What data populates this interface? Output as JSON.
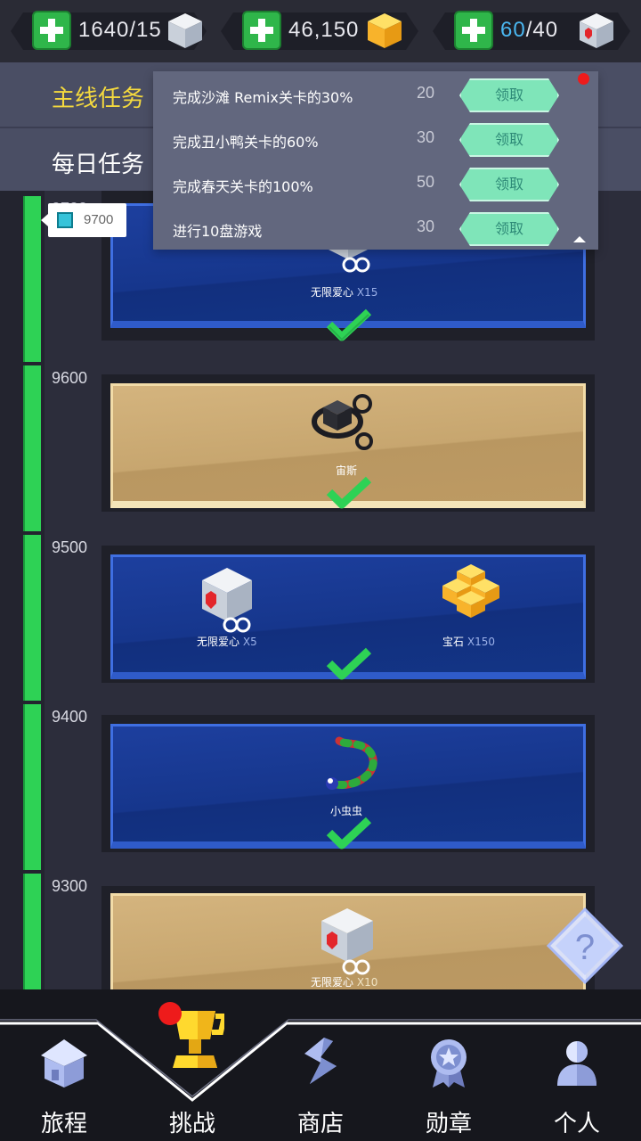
{
  "resources": {
    "lives": {
      "value": "1640/15",
      "icon": "heart-cube-icon"
    },
    "gems": {
      "value": "46,150",
      "icon": "gem-cube-icon"
    },
    "stamina": {
      "current": "60",
      "separator": "/",
      "max": "40",
      "icon": "heart-cube-icon"
    }
  },
  "missions": {
    "main_tab": "主线任务",
    "daily_tab": "每日任务",
    "tasks": [
      {
        "name": "完成沙滩 Remix关卡的30%",
        "points": "20",
        "button": "领取"
      },
      {
        "name": "完成丑小鸭关卡的60%",
        "points": "30",
        "button": "领取"
      },
      {
        "name": "完成春天关卡的100%",
        "points": "50",
        "button": "领取"
      },
      {
        "name": "进行10盘游戏",
        "points": "30",
        "button": "领取"
      }
    ]
  },
  "progress": {
    "current_marker": "9700",
    "partial_top_label": "9700",
    "levels": [
      {
        "score": "9600",
        "style": "gold",
        "rewards": [
          {
            "name": "宙斯",
            "mult": ""
          }
        ],
        "claimed": true
      },
      {
        "score": "9500",
        "style": "blue",
        "rewards": [
          {
            "name": "无限爱心",
            "mult": "X5"
          },
          {
            "name": "宝石",
            "mult": "X150"
          }
        ],
        "claimed": true
      },
      {
        "score": "9400",
        "style": "blue",
        "rewards": [
          {
            "name": "小虫虫",
            "mult": ""
          }
        ],
        "claimed": true
      },
      {
        "score": "9300",
        "style": "gold",
        "rewards": [
          {
            "name": "无限爱心",
            "mult": "X10"
          }
        ],
        "claimed": true
      }
    ],
    "top_card": {
      "style": "blue",
      "reward_name": "无限爱心",
      "reward_mult": "X15",
      "claimed": true
    }
  },
  "help_button": "?",
  "nav": [
    {
      "label": "旅程",
      "icon": "house-icon"
    },
    {
      "label": "挑战",
      "icon": "trophy-icon",
      "active": true
    },
    {
      "label": "商店",
      "icon": "store-icon"
    },
    {
      "label": "勋章",
      "icon": "medal-icon"
    },
    {
      "label": "个人",
      "icon": "person-icon"
    }
  ],
  "colors": {
    "accent_green": "#2ed255",
    "gold_tab": "#f4d93e",
    "card_blue": "#16368c",
    "card_gold": "#c7a66f"
  }
}
